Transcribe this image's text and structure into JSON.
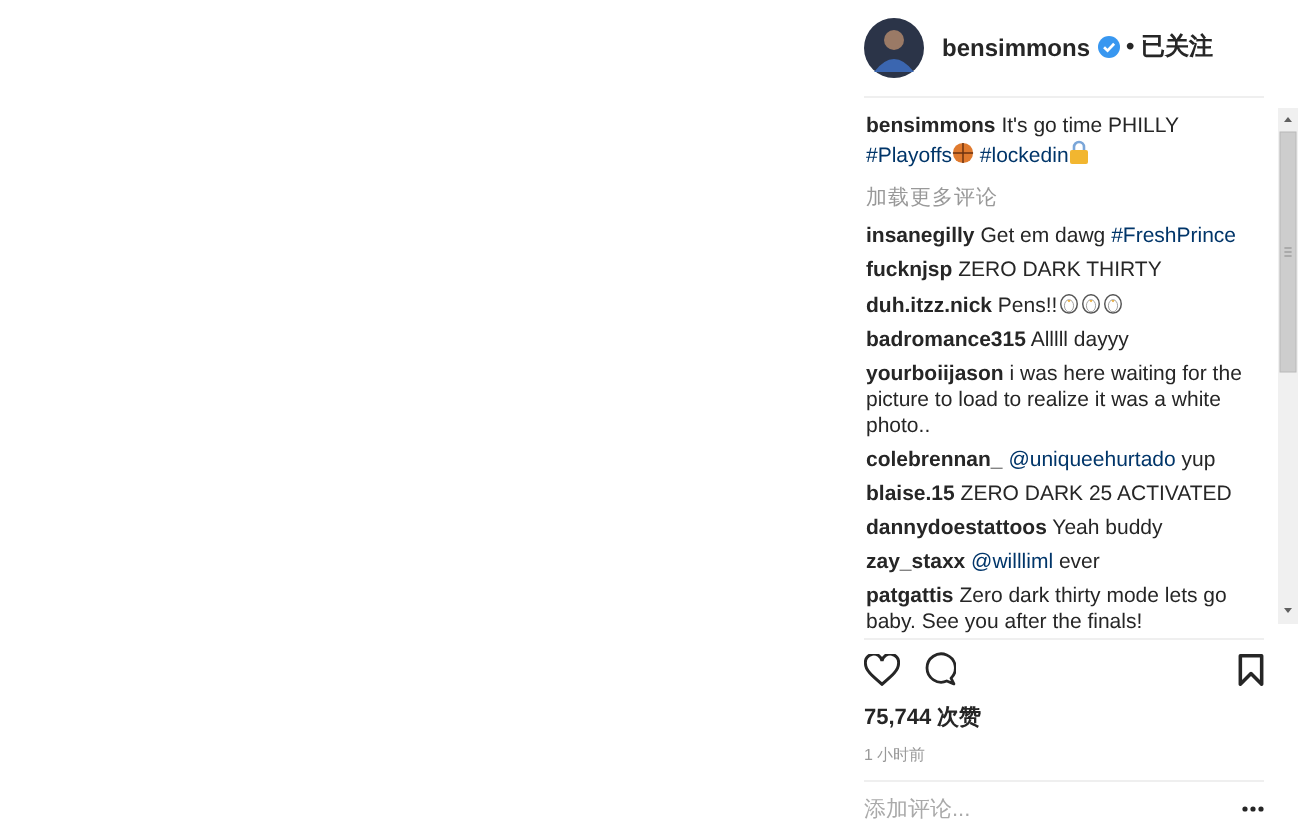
{
  "post": {
    "author": "bensimmons",
    "verified": true,
    "follow_status": "• 已关注",
    "caption": {
      "user": "bensimmons",
      "segments": [
        {
          "kind": "text",
          "text": "It's go time PHILLY "
        },
        {
          "kind": "link",
          "text": "#Playoffs"
        },
        {
          "kind": "basketball"
        },
        {
          "kind": "link",
          "text": "#lockedin"
        },
        {
          "kind": "lock"
        }
      ]
    },
    "load_more": "加载更多评论",
    "comments": [
      {
        "user": "insanegilly",
        "segments": [
          {
            "kind": "text",
            "text": "Get em dawg "
          },
          {
            "kind": "link",
            "text": "#FreshPrince"
          }
        ]
      },
      {
        "user": "fucknjsp",
        "segments": [
          {
            "kind": "text",
            "text": "ZERO DARK THIRTY"
          }
        ]
      },
      {
        "user": "duh.itzz.nick",
        "segments": [
          {
            "kind": "text",
            "text": "Pens!!"
          },
          {
            "kind": "penguin"
          },
          {
            "kind": "penguin"
          },
          {
            "kind": "penguin"
          }
        ]
      },
      {
        "user": "badromance315",
        "segments": [
          {
            "kind": "text",
            "text": "Alllll dayyy"
          }
        ]
      },
      {
        "user": "yourboiijason",
        "segments": [
          {
            "kind": "text",
            "text": "i was here waiting for the picture to load to realize it was a white photo.."
          }
        ]
      },
      {
        "user": "colebrennan_",
        "segments": [
          {
            "kind": "link",
            "text": "@uniqueehurtado"
          },
          {
            "kind": "text",
            "text": " yup"
          }
        ]
      },
      {
        "user": "blaise.15",
        "segments": [
          {
            "kind": "text",
            "text": "ZERO DARK 25 ACTIVATED"
          }
        ]
      },
      {
        "user": "dannydoestattoos",
        "segments": [
          {
            "kind": "text",
            "text": "Yeah buddy"
          }
        ]
      },
      {
        "user": "zay_staxx",
        "segments": [
          {
            "kind": "link",
            "text": "@willliml"
          },
          {
            "kind": "text",
            "text": " ever"
          }
        ]
      },
      {
        "user": "patgattis",
        "segments": [
          {
            "kind": "text",
            "text": "Zero dark thirty mode lets go baby. See you after the finals!"
          }
        ]
      }
    ],
    "likes": "75,744 次赞",
    "time": "1 小时前",
    "comment_field": {
      "placeholder": "添加评论..."
    }
  }
}
